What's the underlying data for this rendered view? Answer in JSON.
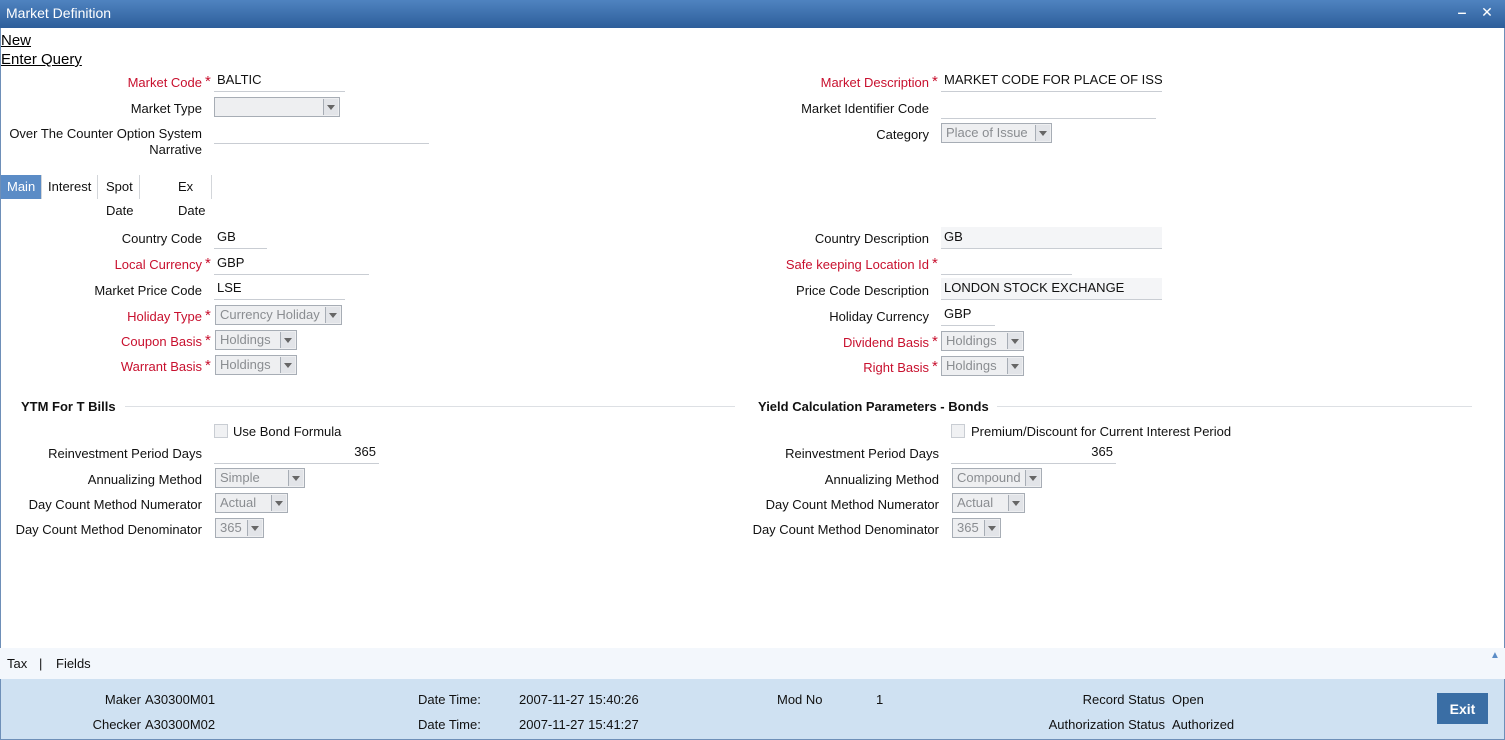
{
  "window": {
    "title": "Market Definition",
    "minimize": "‒",
    "close": "✕"
  },
  "actions": {
    "new": "New",
    "enter_query": "Enter Query"
  },
  "header": {
    "market_code_label": "Market Code",
    "market_code": "BALTIC",
    "market_type_label": "Market Type",
    "market_type": "",
    "otc_label_1": "Over The Counter Option System",
    "otc_label_2": "Narrative",
    "otc_value": "",
    "market_description_label": "Market Description",
    "market_description": "MARKET CODE FOR PLACE OF ISS",
    "mic_label": "Market Identifier Code",
    "mic_value": "",
    "category_label": "Category",
    "category": "Place of Issue"
  },
  "tabs": [
    "Main",
    "Interest",
    "Spot Date",
    "Ex Date"
  ],
  "main": {
    "country_code_label": "Country Code",
    "country_code": "GB",
    "local_currency_label": "Local Currency",
    "local_currency": "GBP",
    "market_price_code_label": "Market Price Code",
    "market_price_code": "LSE",
    "holiday_type_label": "Holiday Type",
    "holiday_type": "Currency Holiday",
    "coupon_basis_label": "Coupon Basis",
    "coupon_basis": "Holdings",
    "warrant_basis_label": "Warrant Basis",
    "warrant_basis": "Holdings",
    "country_description_label": "Country Description",
    "country_description": "GB",
    "safekeeping_label": "Safe keeping Location Id",
    "safekeeping_value": "",
    "price_code_description_label": "Price Code Description",
    "price_code_description": "LONDON STOCK EXCHANGE",
    "holiday_currency_label": "Holiday Currency",
    "holiday_currency": "GBP",
    "dividend_basis_label": "Dividend Basis",
    "dividend_basis": "Holdings",
    "right_basis_label": "Right Basis",
    "right_basis": "Holdings"
  },
  "ytm": {
    "title": "YTM For T Bills",
    "use_bond_formula_label": "Use Bond Formula",
    "reinvestment_label": "Reinvestment Period Days",
    "reinvestment": "365",
    "annualizing_label": "Annualizing Method",
    "annualizing": "Simple",
    "numerator_label": "Day Count Method Numerator",
    "numerator": "Actual",
    "denominator_label": "Day Count Method Denominator",
    "denominator": "365"
  },
  "yield": {
    "title": "Yield Calculation Parameters - Bonds",
    "premium_label": "Premium/Discount for Current Interest Period",
    "reinvestment_label": "Reinvestment Period Days",
    "reinvestment": "365",
    "annualizing_label": "Annualizing Method",
    "annualizing": "Compound",
    "numerator_label": "Day Count Method Numerator",
    "numerator": "Actual",
    "denominator_label": "Day Count Method Denominator",
    "denominator": "365"
  },
  "footer_links": {
    "tax": "Tax",
    "sep": "|",
    "fields": "Fields"
  },
  "status": {
    "maker_label": "Maker",
    "maker": "A30300M01",
    "checker_label": "Checker",
    "checker": "A30300M02",
    "date_time_label": "Date Time:",
    "maker_dt": "2007-11-27 15:40:26",
    "checker_dt": "2007-11-27 15:41:27",
    "mod_no_label": "Mod No",
    "mod_no": "1",
    "record_status_label": "Record Status",
    "record_status": "Open",
    "auth_status_label": "Authorization Status",
    "auth_status": "Authorized"
  },
  "buttons": {
    "exit": "Exit"
  }
}
